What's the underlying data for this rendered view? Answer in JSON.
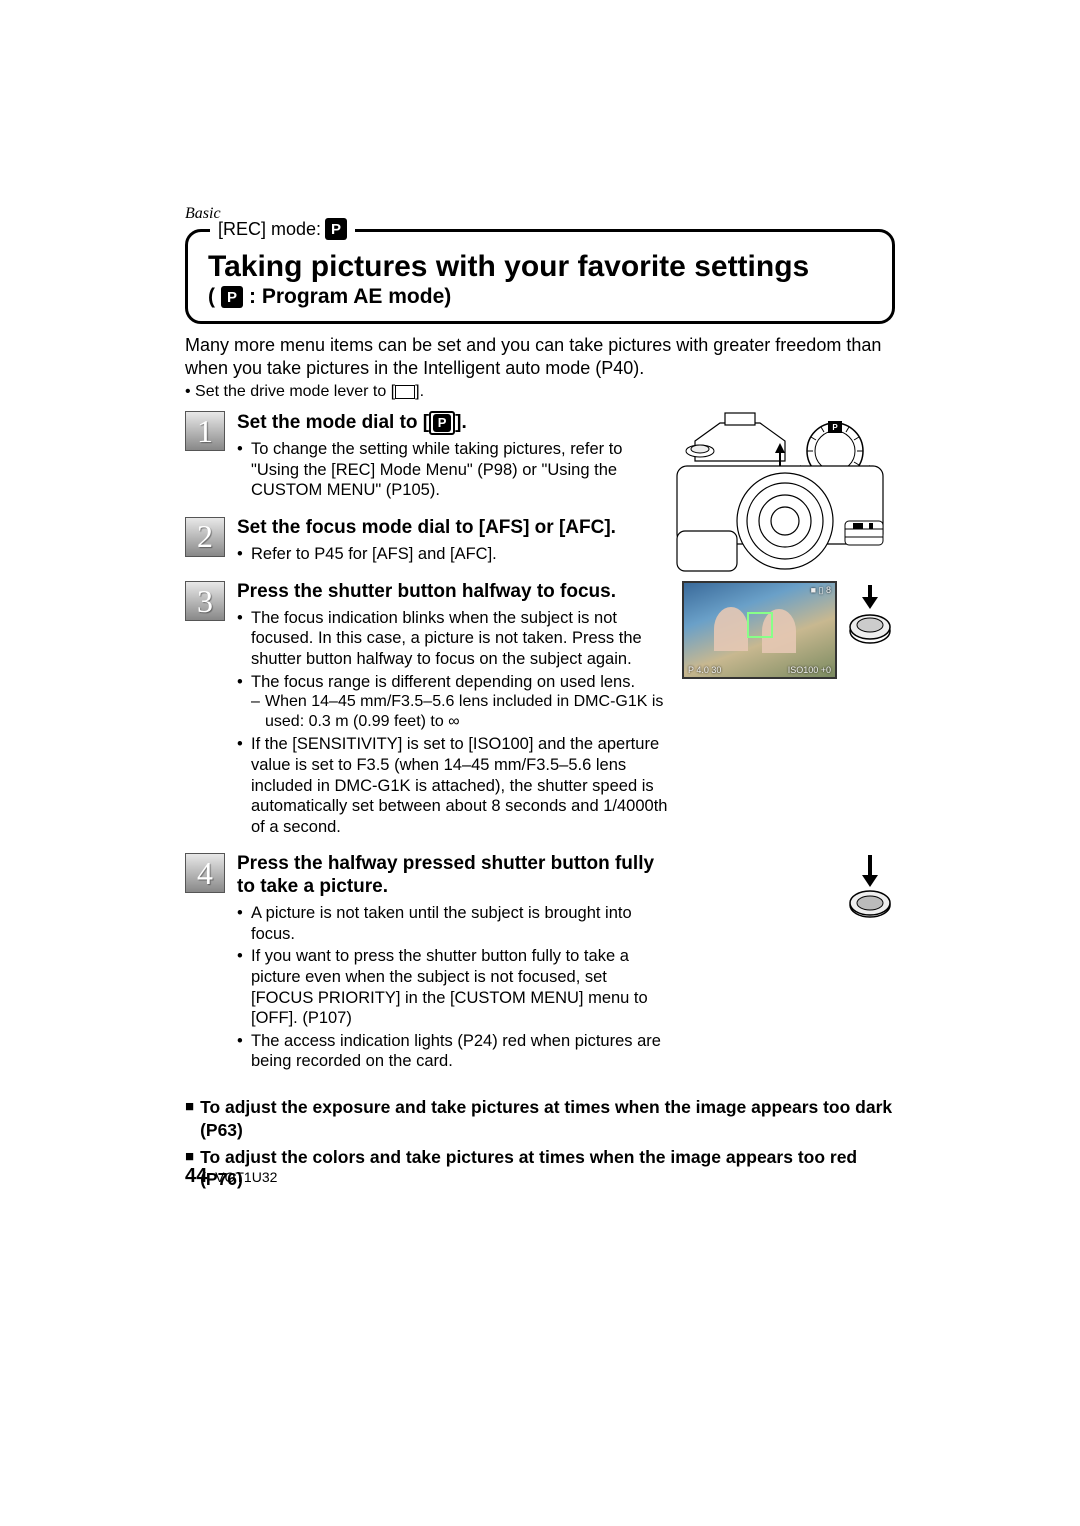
{
  "section_label": "Basic",
  "rec_mode_label": "[REC] mode:",
  "p_glyph": "P",
  "title_main": "Taking pictures with your favorite settings",
  "title_sub_suffix": ": Program AE mode)",
  "title_sub_prefix": "(",
  "intro": "Many more menu items can be set and you can take pictures with greater freedom than when you take pictures in the Intelligent auto mode (P40).",
  "intro_bullet": "Set the drive mode lever to [",
  "intro_bullet_suffix": "].",
  "steps": {
    "s1": {
      "num": "1",
      "title_a": "Set the mode dial to [",
      "title_b": "].",
      "bullets": [
        "To change the setting while taking pictures, refer to \"Using the [REC] Mode Menu\" (P98) or \"Using the CUSTOM MENU\" (P105)."
      ]
    },
    "s2": {
      "num": "2",
      "title": "Set the focus mode dial to [AFS] or [AFC].",
      "bullets": [
        "Refer to P45 for [AFS] and [AFC]."
      ]
    },
    "s3": {
      "num": "3",
      "title": "Press the shutter button halfway to focus.",
      "bullets": [
        "The focus indication blinks when the subject is not focused. In this case, a picture is not taken. Press the shutter button halfway to focus on the subject again.",
        "The focus range is different depending on used lens.",
        "If the [SENSITIVITY] is set to [ISO100] and the aperture value is set to F3.5 (when 14–45 mm/F3.5–5.6 lens included in DMC-G1K is attached), the shutter speed is automatically set between about 8 seconds and 1/4000th of a second."
      ],
      "sub": "When 14–45 mm/F3.5–5.6 lens included in DMC-G1K is used: 0.3 m (0.99 feet) to ∞"
    },
    "s4": {
      "num": "4",
      "title": "Press the halfway pressed shutter button fully to take a picture.",
      "bullets": [
        "A picture is not taken until the subject is brought into focus.",
        "If you want to press the shutter button fully to take a picture even when the subject is not focused, set [FOCUS PRIORITY] in the [CUSTOM MENU] menu to [OFF]. (P107)",
        "The access indication lights (P24) red when pictures are being recorded on the card."
      ]
    }
  },
  "tail": [
    "To adjust the exposure and take pictures at times when the image appears too dark (P63)",
    "To adjust the colors and take pictures at times when the image appears too red (P76)"
  ],
  "lcd": {
    "top": "■ ▯ 8",
    "bot_left": "P  4.0  30",
    "bot_right": "ISO100  +0"
  },
  "footer": {
    "page": "44",
    "code": "VQT1U32"
  }
}
